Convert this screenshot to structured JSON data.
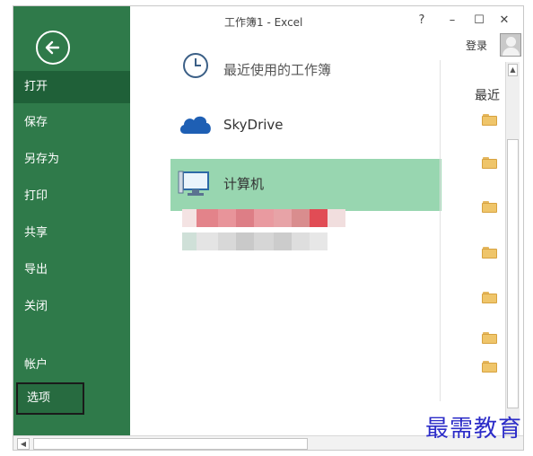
{
  "window": {
    "title": "工作簿1 - Excel"
  },
  "titlebar_controls": [
    {
      "name": "help",
      "glyph": "?"
    },
    {
      "name": "minimize",
      "glyph": "–"
    },
    {
      "name": "maximize",
      "glyph": "☐"
    },
    {
      "name": "close",
      "glyph": "✕"
    }
  ],
  "account": {
    "login_label": "登录"
  },
  "nav": {
    "items": [
      "打开",
      "保存",
      "另存为",
      "打印",
      "共享",
      "导出",
      "关闭",
      "帐户",
      "选项"
    ],
    "active_item": "打开",
    "highlighted_item": "选项"
  },
  "places": {
    "recent": "最近使用的工作簿",
    "skydrive": "SkyDrive",
    "computer": "计算机"
  },
  "recent_folders": {
    "title": "最近",
    "top_text": "",
    "count": 7
  },
  "colors": {
    "nav_background": "#2f7a4a",
    "nav_active": "#1f6038",
    "computer_highlight": "#98d6b0",
    "folder": "#efc56a",
    "skydrive_cloud": "#1e5fb4"
  },
  "watermark": "最需教育"
}
